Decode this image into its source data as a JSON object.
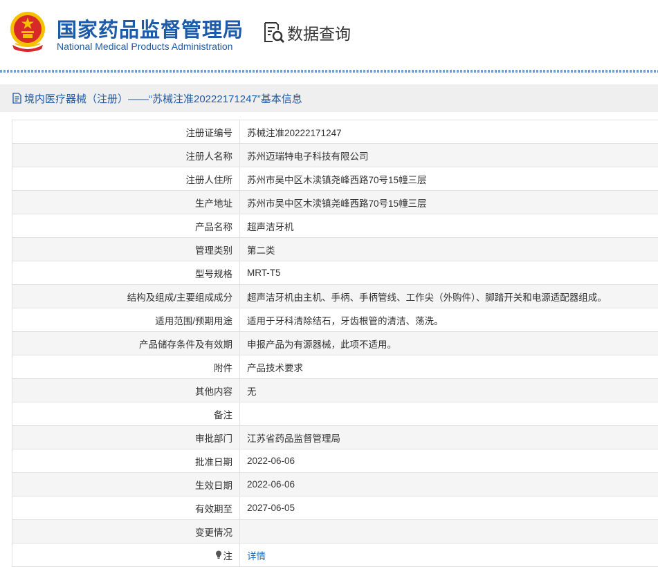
{
  "header": {
    "org_name_cn": "国家药品监督管理局",
    "org_name_en": "National Medical Products Administration",
    "query_label": "数据查询",
    "icons": {
      "emblem": "national-emblem",
      "query": "search-document-icon"
    }
  },
  "section": {
    "title": "境内医疗器械（注册）——“苏械注准20222171247”基本信息",
    "icon": "document-icon"
  },
  "rows": [
    {
      "label": "注册证编号",
      "value": "苏械注准20222171247"
    },
    {
      "label": "注册人名称",
      "value": "苏州迈瑞特电子科技有限公司"
    },
    {
      "label": "注册人住所",
      "value": "苏州市吴中区木渎镇尧峰西路70号15幢三层"
    },
    {
      "label": "生产地址",
      "value": "苏州市吴中区木渎镇尧峰西路70号15幢三层"
    },
    {
      "label": "产品名称",
      "value": "超声洁牙机"
    },
    {
      "label": "管理类别",
      "value": "第二类"
    },
    {
      "label": "型号规格",
      "value": "MRT-T5"
    },
    {
      "label": "结构及组成/主要组成成分",
      "value": "超声洁牙机由主机、手柄、手柄管线、工作尖（外购件）、脚踏开关和电源适配器组成。"
    },
    {
      "label": "适用范围/预期用途",
      "value": "适用于牙科清除结石，牙齿根管的清洁、荡洗。"
    },
    {
      "label": "产品储存条件及有效期",
      "value": "申报产品为有源器械，此项不适用。"
    },
    {
      "label": "附件",
      "value": "产品技术要求"
    },
    {
      "label": "其他内容",
      "value": "无"
    },
    {
      "label": "备注",
      "value": ""
    },
    {
      "label": "审批部门",
      "value": "江苏省药品监督管理局"
    },
    {
      "label": "批准日期",
      "value": "2022-06-06"
    },
    {
      "label": "生效日期",
      "value": "2022-06-06"
    },
    {
      "label": "有效期至",
      "value": "2027-06-05"
    },
    {
      "label": "变更情况",
      "value": ""
    }
  ],
  "note_row": {
    "label": "注",
    "link_text": "详情",
    "icon": "lightbulb-icon"
  },
  "colors": {
    "brand_blue": "#1d5aa8",
    "link_blue": "#1d6fc1",
    "emblem_red": "#d7282a",
    "emblem_gold": "#f5c000"
  }
}
